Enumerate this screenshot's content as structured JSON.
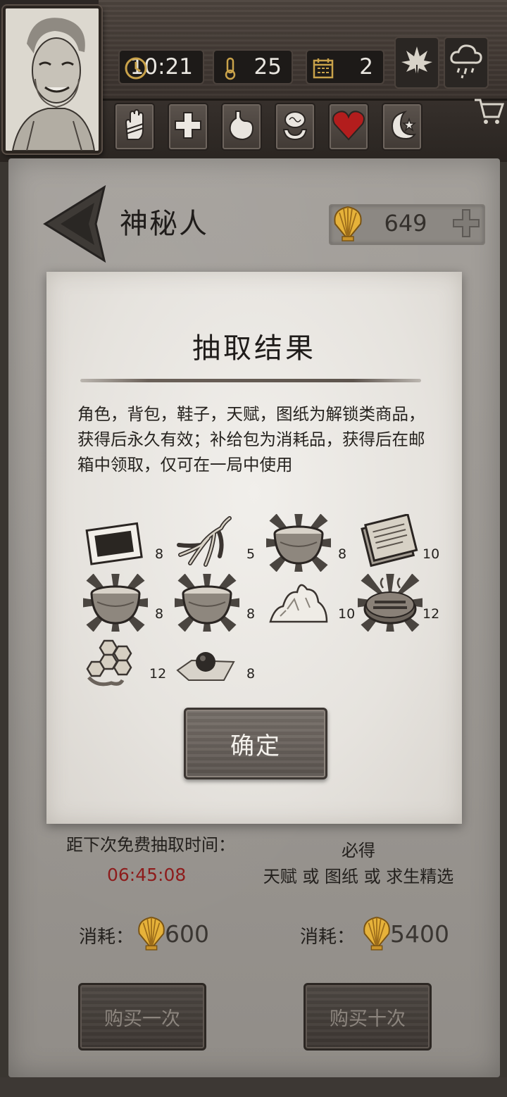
{
  "hud": {
    "time": "10:21",
    "temperature": "25",
    "day": "2",
    "icons": [
      "clock-icon",
      "thermometer-icon",
      "calendar-icon",
      "leaf-icon",
      "rain-cloud-icon",
      "cart-icon"
    ],
    "status_icons": [
      "hand-icon",
      "health-cross-icon",
      "stomach-icon",
      "brain-icon",
      "heart-icon",
      "moon-icon"
    ]
  },
  "header": {
    "title": "神秘人",
    "shells": "649"
  },
  "dialog": {
    "title": "抽取结果",
    "description": "角色，背包，鞋子，天赋，图纸为解锁类商品，获得后永久有效；补给包为消耗品，获得后在邮箱中领取，仅可在一局中使用",
    "items": [
      {
        "icon": "tray-icon",
        "count": "8",
        "highlight": false
      },
      {
        "icon": "root-icon",
        "count": "5",
        "highlight": false
      },
      {
        "icon": "bowl-icon",
        "count": "8",
        "highlight": true
      },
      {
        "icon": "book-icon",
        "count": "10",
        "highlight": false
      },
      {
        "icon": "bowl-icon",
        "count": "8",
        "highlight": true
      },
      {
        "icon": "bowl-icon",
        "count": "8",
        "highlight": true
      },
      {
        "icon": "salt-pile-icon",
        "count": "10",
        "highlight": false
      },
      {
        "icon": "cooked-meat-icon",
        "count": "12",
        "highlight": true
      },
      {
        "icon": "honeycomb-icon",
        "count": "12",
        "highlight": false
      },
      {
        "icon": "pill-icon",
        "count": "8",
        "highlight": false
      }
    ],
    "confirm_label": "确定"
  },
  "bottom": {
    "free_label": "距下次免费抽取时间：",
    "timer": "06:45:08",
    "must_label": "必得",
    "must_items": "天赋 或 图纸 或 求生精选",
    "cost_label_1": "消耗：",
    "cost_value_1": "600",
    "cost_label_2": "消耗：",
    "cost_value_2": "5400",
    "buy_once": "购买一次",
    "buy_ten": "购买十次"
  },
  "colors": {
    "timer_red": "#8d1c1c",
    "heart_red": "#b31d1d",
    "shell_gold": "#e6b23a"
  }
}
